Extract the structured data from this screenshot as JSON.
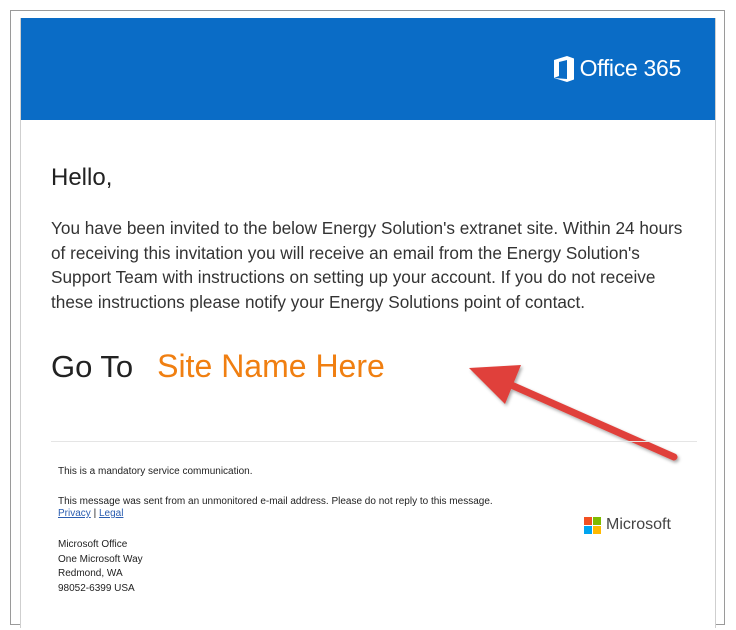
{
  "header": {
    "brand_name": "Office 365",
    "brand_color": "#0a6cc6",
    "brand_icon": "office-logo-icon"
  },
  "body": {
    "greeting": "Hello,",
    "message": "You have been invited to the below Energy Solution's extranet site. Within 24 hours of receiving this invitation you will receive an email from the Energy Solution's Support Team with instructions on setting up your account. If you do not receive these instructions please notify your Energy Solutions point of contact.",
    "goto_label": "Go To",
    "site_link": "Site Name Here",
    "site_link_color": "#f07f11",
    "arrow_color": "#e0413a"
  },
  "footer": {
    "mandatory_note": "This is a mandatory service communication.",
    "noreply_note": "This message was sent from an unmonitored e-mail address. Please do not reply to this message.",
    "privacy_label": "Privacy",
    "separator": "|",
    "legal_label": "Legal",
    "address": {
      "line1": "Microsoft Office",
      "line2": "One Microsoft Way",
      "line3": "Redmond, WA",
      "line4": "98052-6399 USA"
    },
    "ms_name": "Microsoft",
    "ms_icon": "microsoft-logo-icon"
  }
}
